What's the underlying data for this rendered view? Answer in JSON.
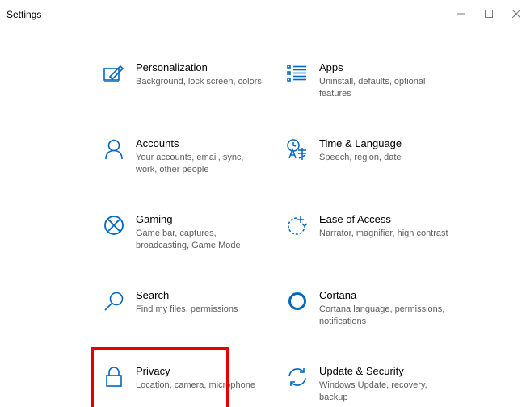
{
  "window": {
    "title": "Settings"
  },
  "tiles": [
    {
      "title": "Personalization",
      "desc": "Background, lock screen, colors",
      "icon": "personalization-icon"
    },
    {
      "title": "Apps",
      "desc": "Uninstall, defaults, optional features",
      "icon": "apps-icon"
    },
    {
      "title": "Accounts",
      "desc": "Your accounts, email, sync, work, other people",
      "icon": "accounts-icon"
    },
    {
      "title": "Time & Language",
      "desc": "Speech, region, date",
      "icon": "time-language-icon"
    },
    {
      "title": "Gaming",
      "desc": "Game bar, captures, broadcasting, Game Mode",
      "icon": "gaming-icon"
    },
    {
      "title": "Ease of Access",
      "desc": "Narrator, magnifier, high contrast",
      "icon": "ease-of-access-icon"
    },
    {
      "title": "Search",
      "desc": "Find my files, permissions",
      "icon": "search-icon"
    },
    {
      "title": "Cortana",
      "desc": "Cortana language, permissions, notifications",
      "icon": "cortana-icon"
    },
    {
      "title": "Privacy",
      "desc": "Location, camera, microphone",
      "icon": "privacy-icon"
    },
    {
      "title": "Update & Security",
      "desc": "Windows Update, recovery, backup",
      "icon": "update-security-icon"
    }
  ],
  "colors": {
    "accent": "#0067c0",
    "highlight": "#e60000"
  }
}
